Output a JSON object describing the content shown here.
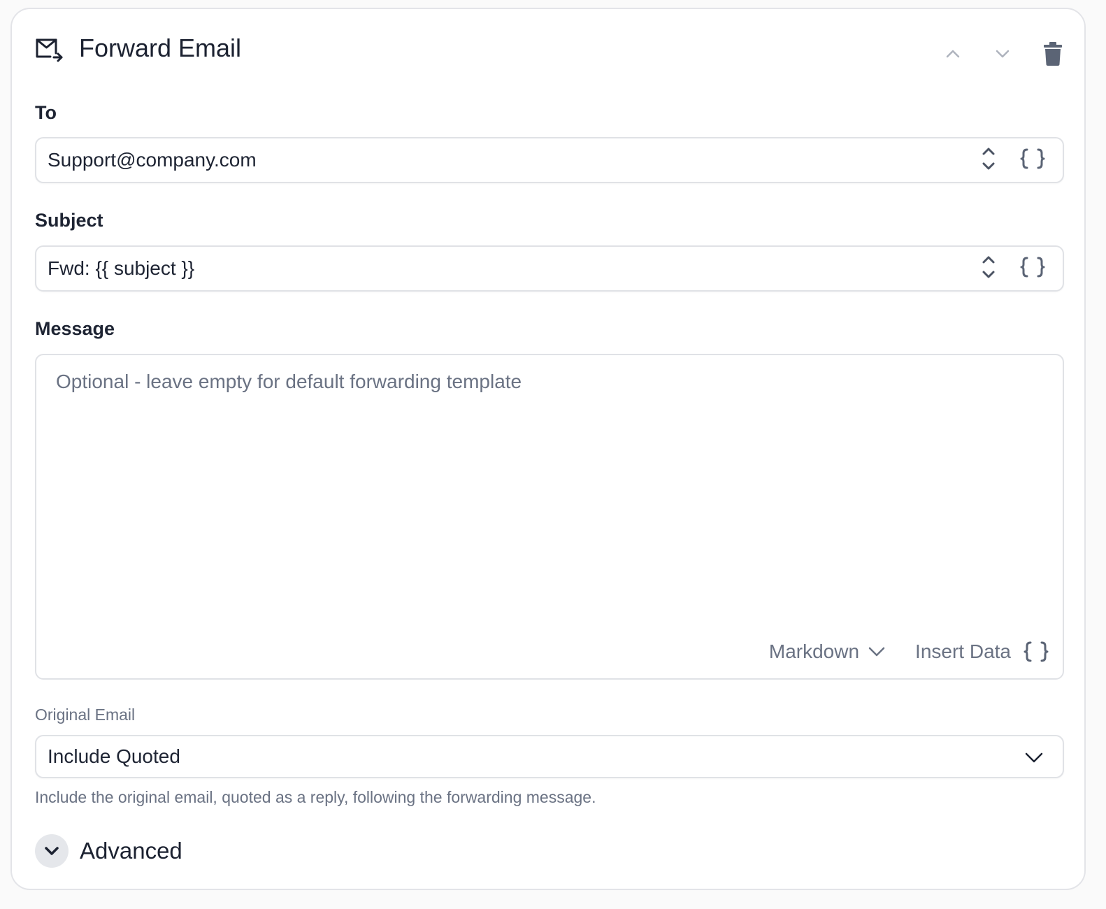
{
  "header": {
    "title": "Forward Email",
    "icon": "mail-forward-icon"
  },
  "to": {
    "label": "To",
    "value": "Support@company.com"
  },
  "subject": {
    "label": "Subject",
    "value": "Fwd: {{ subject }}"
  },
  "message": {
    "label": "Message",
    "placeholder": "Optional - leave empty for default forwarding template",
    "format": "Markdown",
    "insert_label": "Insert Data"
  },
  "original_email": {
    "label": "Original Email",
    "selected": "Include Quoted",
    "helper": "Include the original email, quoted as a reply, following the forwarding message."
  },
  "advanced": {
    "label": "Advanced"
  },
  "colors": {
    "text": "#1e2433",
    "muted": "#6a7283",
    "border": "#e0e2e6",
    "icon": "#5b6475"
  }
}
